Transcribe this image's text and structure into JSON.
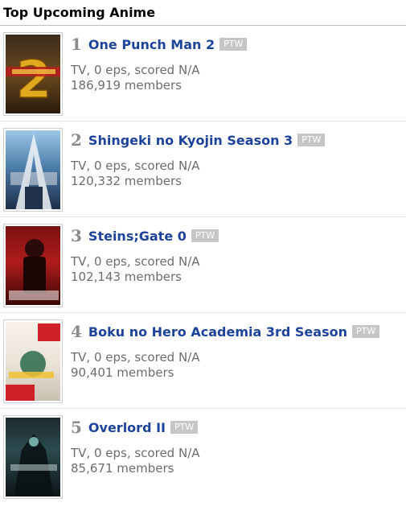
{
  "header": {
    "title": "Top Upcoming Anime"
  },
  "items": [
    {
      "rank": "1",
      "title": "One Punch Man 2",
      "ptw": "PTW",
      "type_line": "TV, 0 eps, scored N/A",
      "members": "186,919 members"
    },
    {
      "rank": "2",
      "title": "Shingeki no Kyojin Season 3",
      "ptw": "PTW",
      "type_line": "TV, 0 eps, scored N/A",
      "members": "120,332 members"
    },
    {
      "rank": "3",
      "title": "Steins;Gate 0",
      "ptw": "PTW",
      "type_line": "TV, 0 eps, scored N/A",
      "members": "102,143 members"
    },
    {
      "rank": "4",
      "title": "Boku no Hero Academia 3rd Season",
      "ptw": "PTW",
      "type_line": "TV, 0 eps, scored N/A",
      "members": "90,401 members"
    },
    {
      "rank": "5",
      "title": "Overlord II",
      "ptw": "PTW",
      "type_line": "TV, 0 eps, scored N/A",
      "members": "85,671 members"
    }
  ]
}
